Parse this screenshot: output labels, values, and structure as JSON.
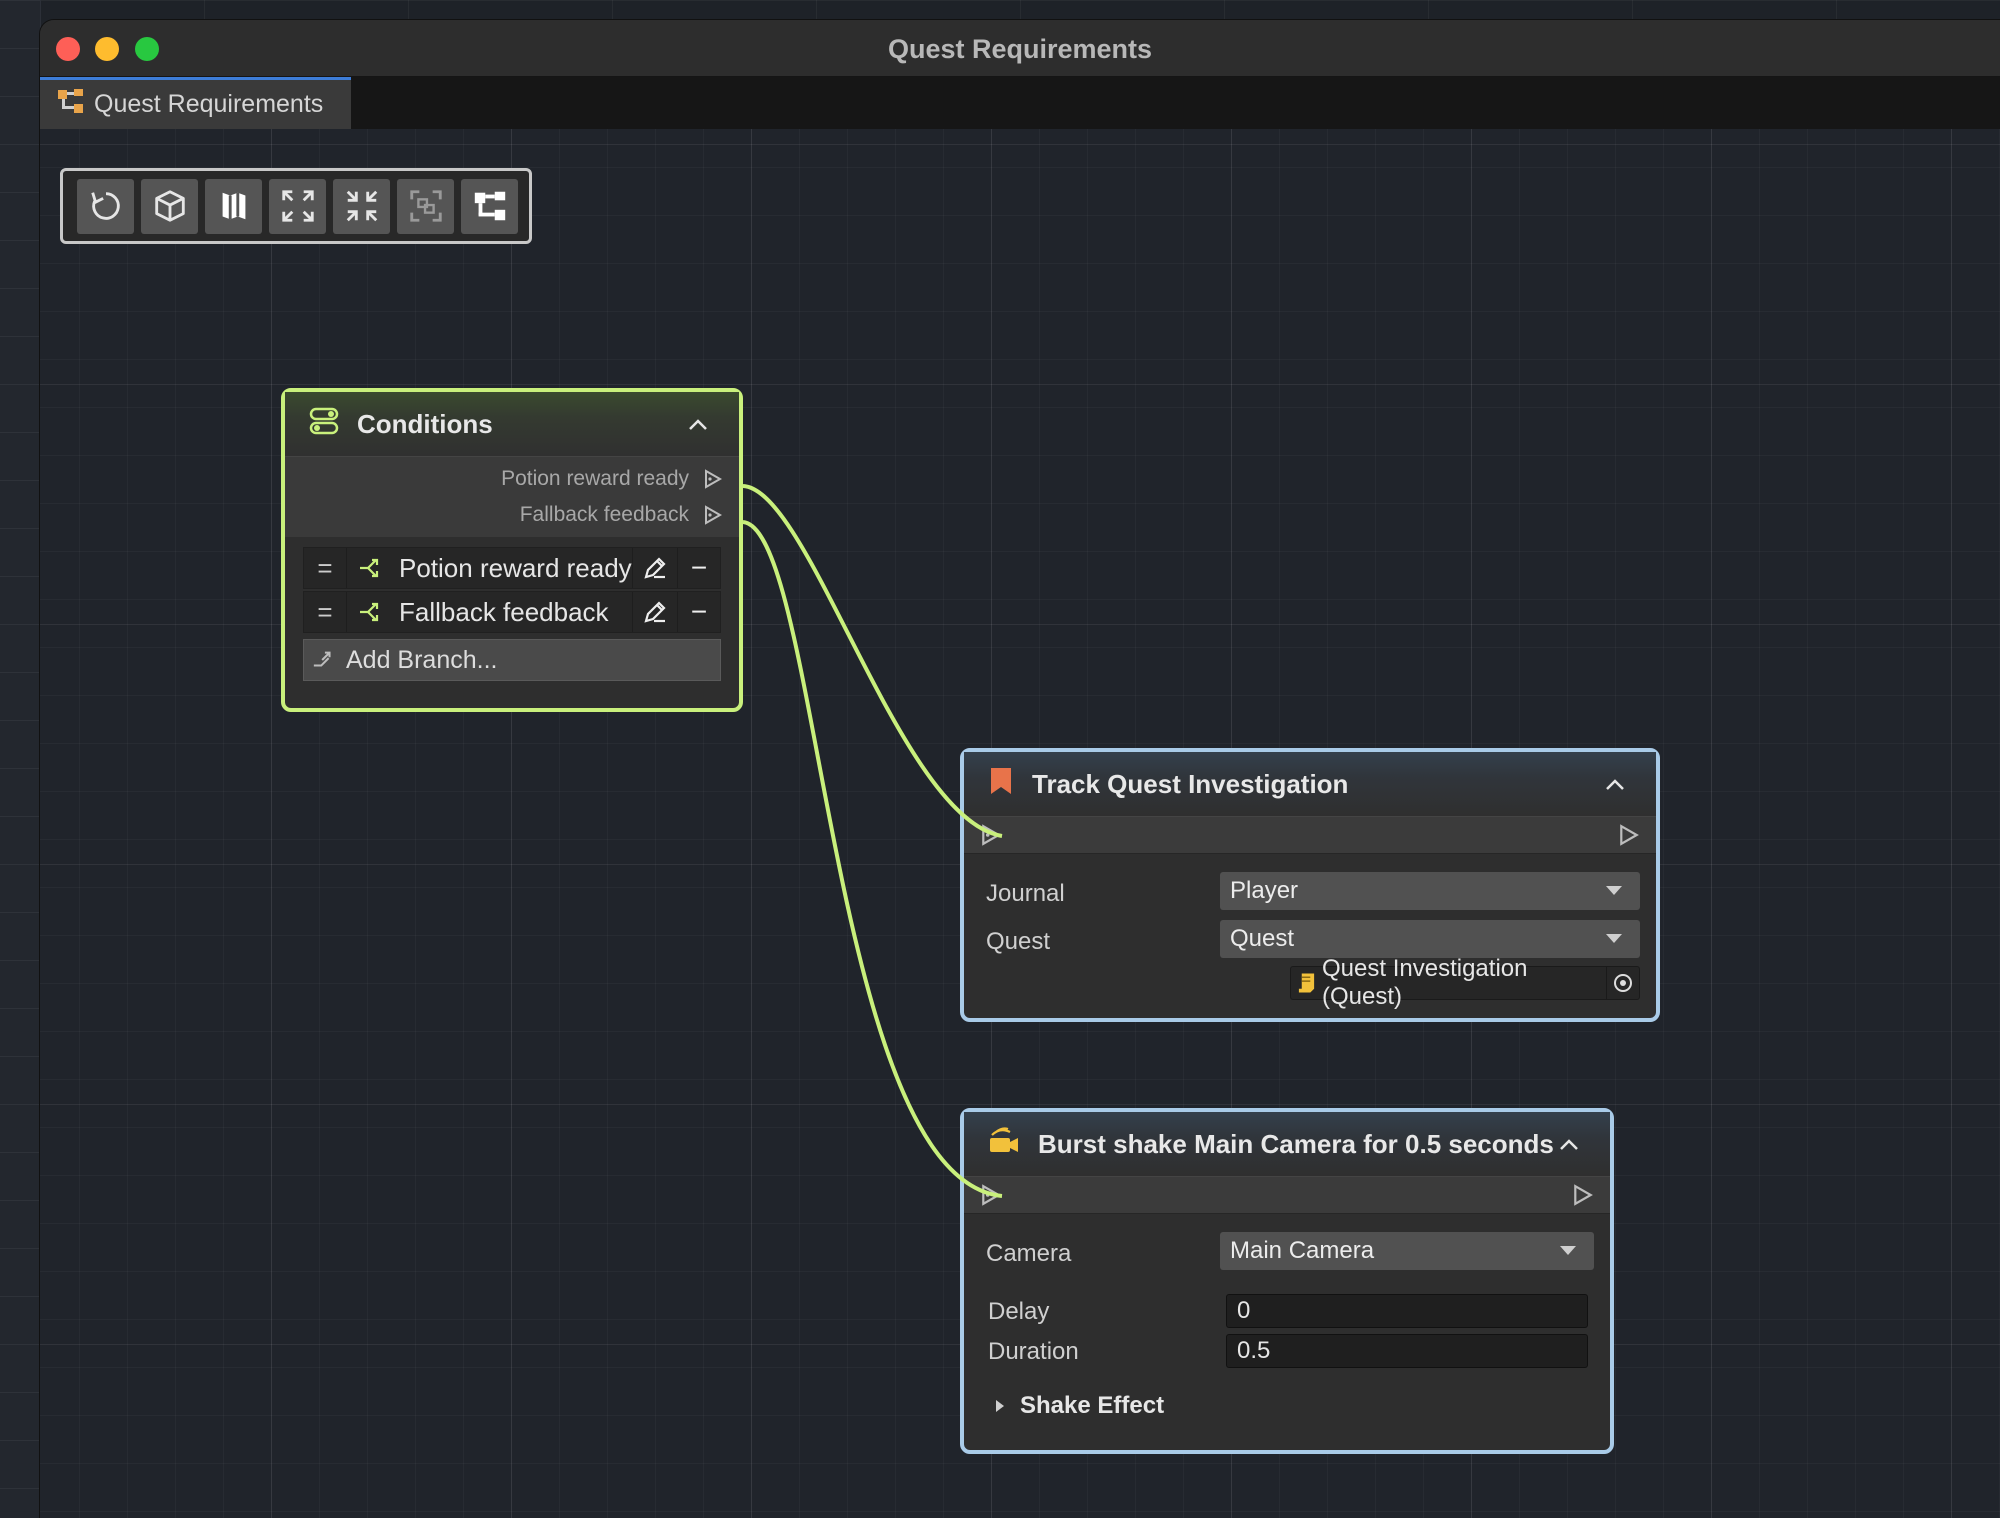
{
  "window": {
    "title": "Quest Requirements"
  },
  "tab": {
    "label": "Quest Requirements"
  },
  "toolbar": {
    "buttons": [
      "refresh-icon",
      "cube-icon",
      "map-icon",
      "expand-icon",
      "collapse-icon",
      "frame-select-icon",
      "hierarchy-icon"
    ]
  },
  "conditions_node": {
    "title": "Conditions",
    "outputs": [
      "Potion reward ready",
      "Fallback feedback"
    ],
    "branches": [
      {
        "label": "Potion reward ready",
        "handle": "=",
        "remove": "−"
      },
      {
        "label": "Fallback feedback",
        "handle": "=",
        "remove": "−"
      }
    ],
    "add_branch_label": "Add Branch..."
  },
  "track_node": {
    "title": "Track Quest Investigation",
    "journal_label": "Journal",
    "journal_value": "Player",
    "quest_label": "Quest",
    "quest_value": "Quest",
    "quest_object": "Quest Investigation (Quest)"
  },
  "shake_node": {
    "title": "Burst shake Main Camera for 0.5 seconds",
    "camera_label": "Camera",
    "camera_value": "Main Camera",
    "delay_label": "Delay",
    "delay_value": "0",
    "duration_label": "Duration",
    "duration_value": "0.5",
    "section_label": "Shake Effect"
  },
  "colors": {
    "condition_accent": "#c9f07c",
    "action_accent": "#a9cbe8",
    "quest_icon": "#e8734a",
    "shake_icon": "#f2c13b"
  }
}
